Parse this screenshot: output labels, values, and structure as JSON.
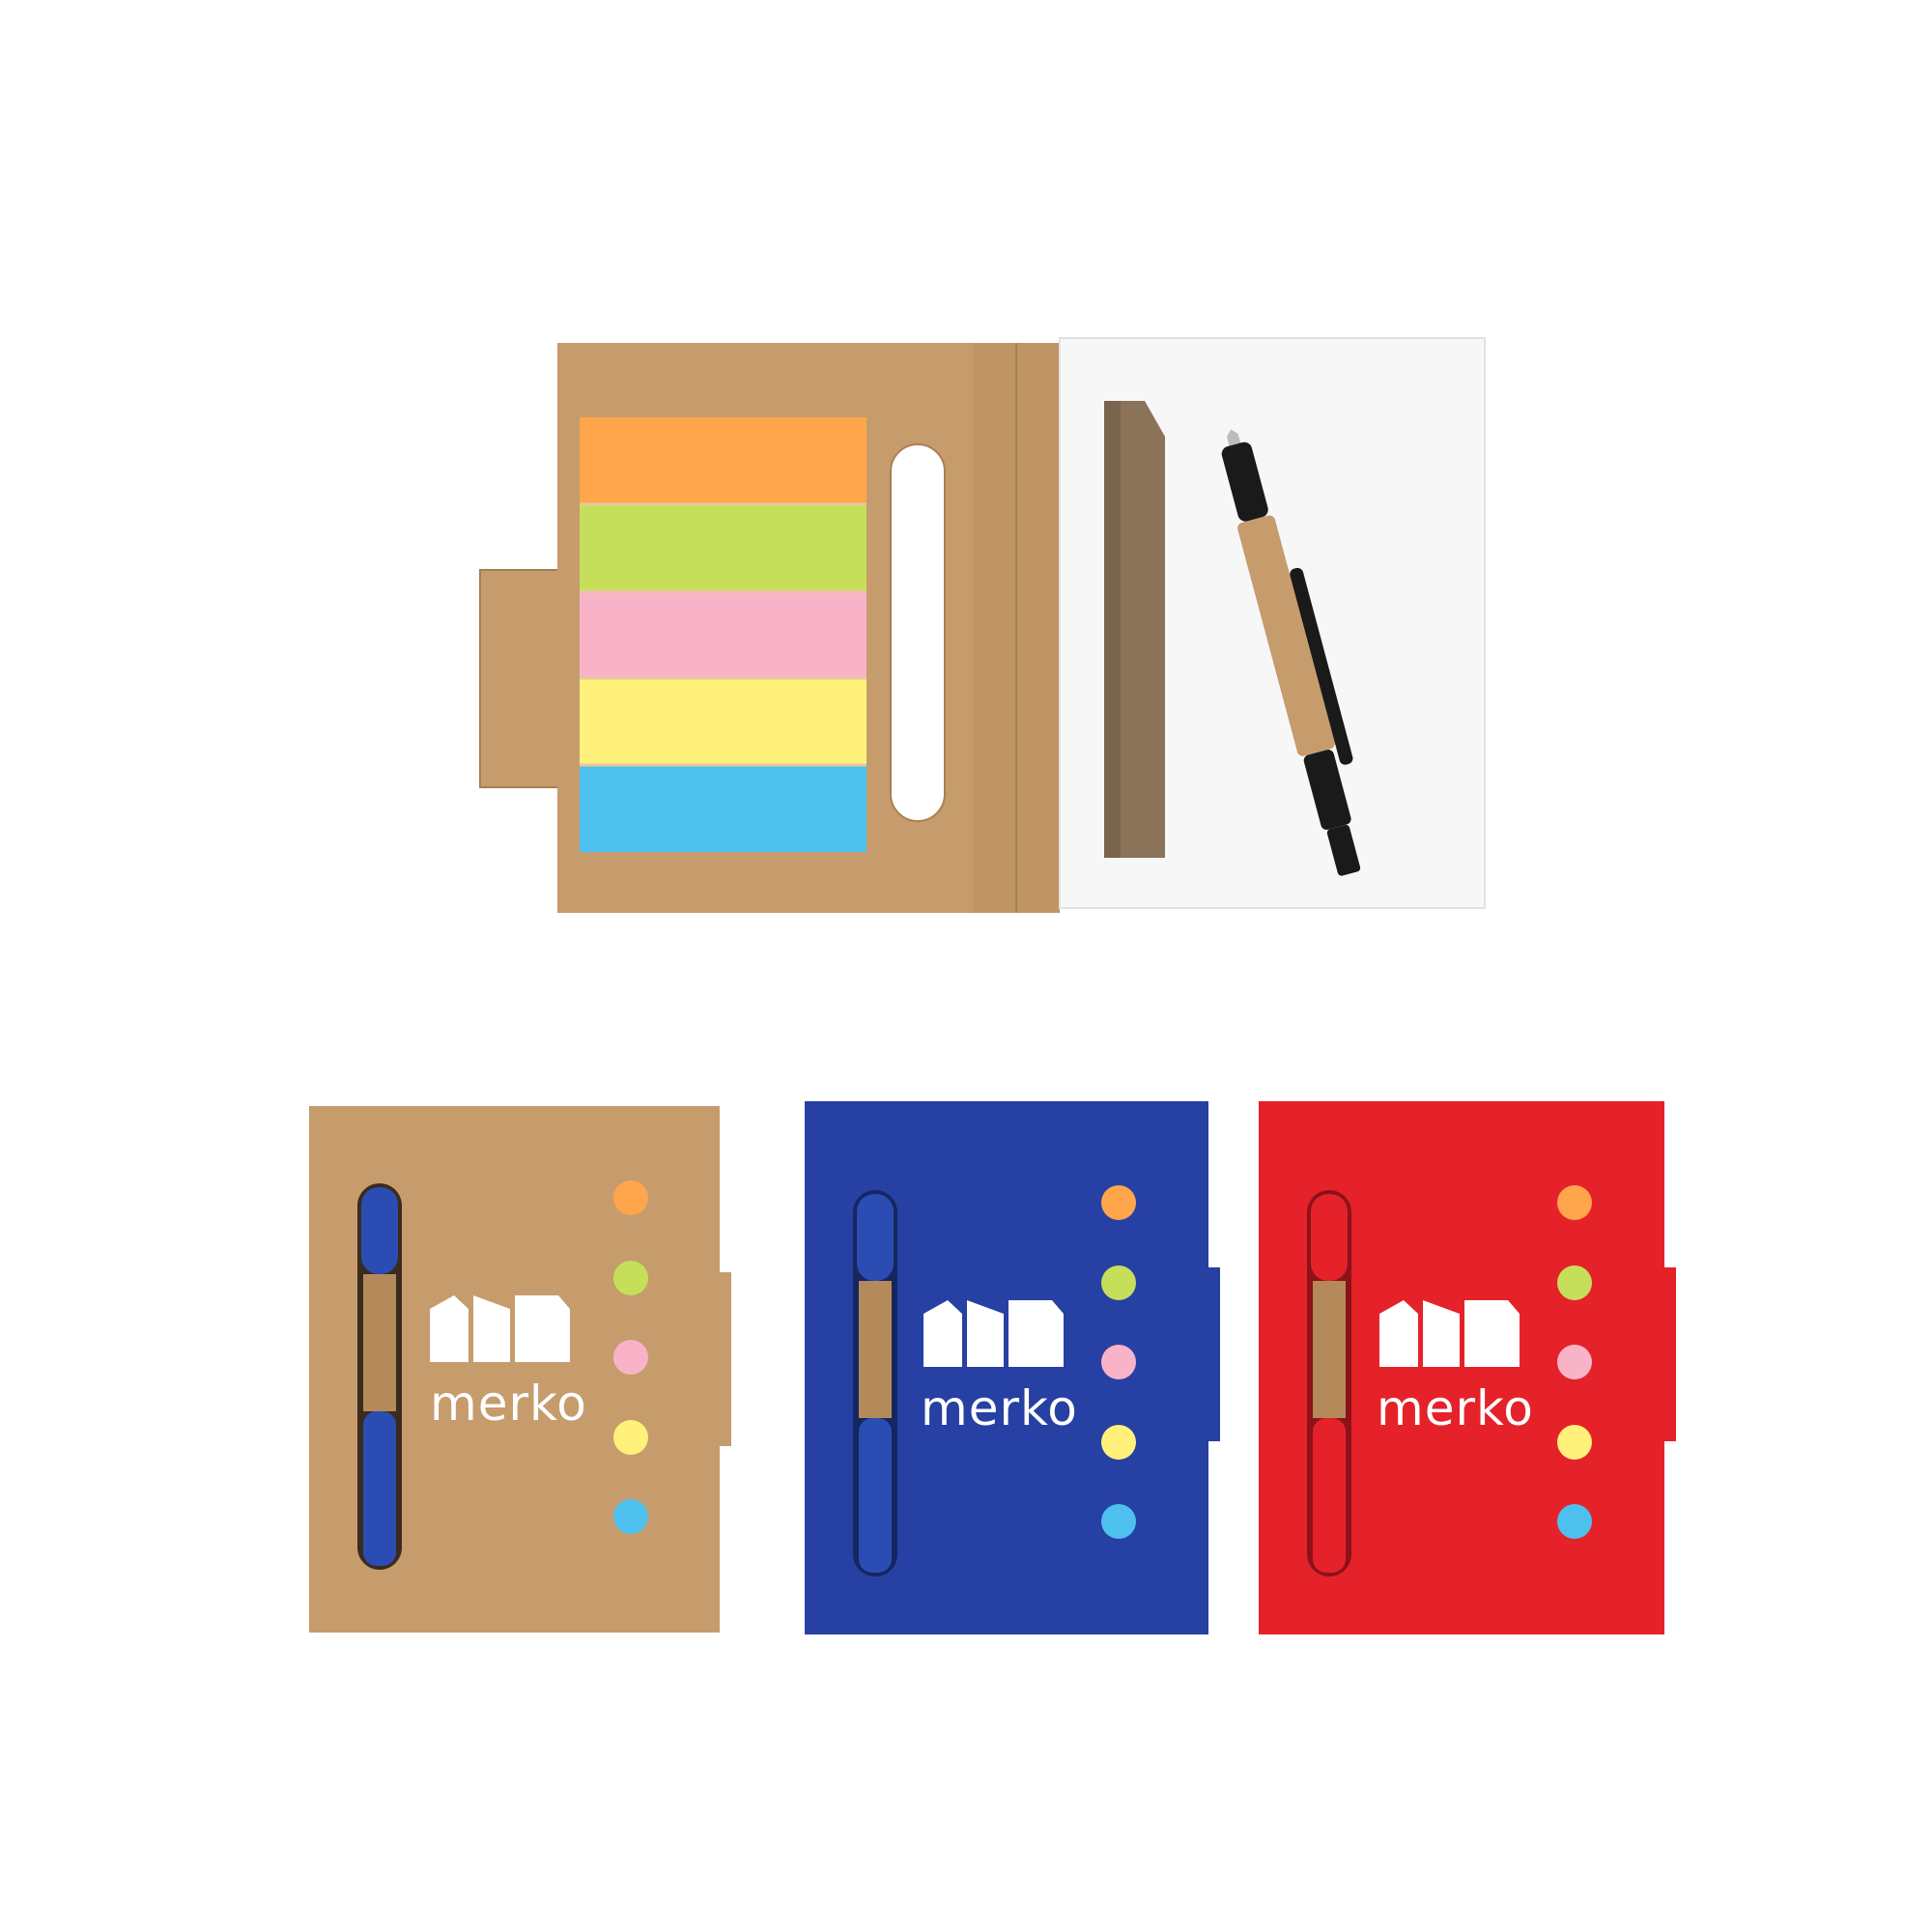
{
  "open_notebook": {
    "cover_color": "#c69c6d",
    "page_color": "#f7f7f7",
    "sticky_tabs": [
      {
        "color": "#ffa64d"
      },
      {
        "color": "#c5df5a"
      },
      {
        "color": "#f9b3c8"
      },
      {
        "color": "#fff17a"
      },
      {
        "color": "#4dc0ee"
      }
    ],
    "pen": {
      "body_color": "#c69c6d",
      "trim_color": "#1a1a1a"
    }
  },
  "closed_notebooks": [
    {
      "variant": "kraft",
      "cover_color": "#c69c6d",
      "pen_color": "#2b4db3",
      "logo_text": "merko"
    },
    {
      "variant": "blue",
      "cover_color": "#2740a3",
      "pen_color": "#2b4db3",
      "logo_text": "merko"
    },
    {
      "variant": "red",
      "cover_color": "#e5222a",
      "pen_color": "#e5222a",
      "logo_text": "merko"
    }
  ],
  "dot_colors": [
    "#ffa64d",
    "#c5df5a",
    "#f9b3c8",
    "#fff17a",
    "#4dc0ee"
  ]
}
